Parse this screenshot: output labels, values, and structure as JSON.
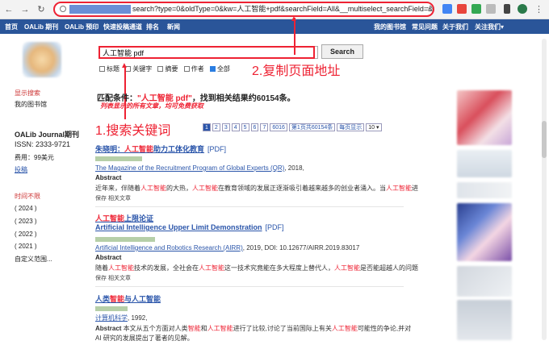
{
  "browser": {
    "url": "search?type=0&oldType=0&kw=人工智能+pdf&searchField=All&__multiselect_searchField=&fromYear=&to",
    "back_icon": "←",
    "forward_icon": "→",
    "reload_icon": "↻"
  },
  "topbar": {
    "items": [
      "首页",
      "OALib 期刊",
      "OALib 预印",
      "快速投稿通道",
      "排名",
      "新闻"
    ],
    "right_items": [
      "我的图书馆",
      "常见问题",
      "关于我们",
      "关注我们▾"
    ]
  },
  "search": {
    "value": "人工智能 pdf",
    "button": "Search",
    "filters": [
      {
        "label": "标题",
        "checked": false
      },
      {
        "label": "关键字",
        "checked": false
      },
      {
        "label": "摘要",
        "checked": false
      },
      {
        "label": "作者",
        "checked": false
      },
      {
        "label": "全部",
        "checked": true
      }
    ]
  },
  "annotations": {
    "copy_url": "2.复制页面地址",
    "search_keyword": "1.搜索关键词"
  },
  "sidebar": {
    "show_search": "显示搜索",
    "my_library": "我的图书馆",
    "journal": "OALib Journal期刊",
    "issn": "ISSN: 2333-9721",
    "fee": "费用：99美元",
    "submit": "投稿",
    "time_limit": "时间不限",
    "years": [
      "( 2024 )",
      "( 2023 )",
      "( 2022 )",
      "( 2021 )"
    ],
    "custom_range": "自定义范围..."
  },
  "results_header": {
    "prefix": "匹配条件：",
    "keyword": "\"人工智能 pdf\"",
    "suffix": "，找到相关结果约60154条。",
    "note": "列表显示的所有文章，均可免费获取"
  },
  "pagination": {
    "pages": [
      "1",
      "2",
      "3",
      "4",
      "5",
      "6",
      "7",
      "6016"
    ],
    "page_label": "第1页共60154条",
    "per_page_label": "每页显示",
    "per_page_value": "10 ▾"
  },
  "results": [
    {
      "title_plain_1": "朱晓明：",
      "title_hl": "人工智能",
      "title_plain_2": "助力工体化教育",
      "tag": "[PDF]",
      "source_link": "The Magazine of the Recruitment Program of Global Experts (QR)",
      "source_rest": ", 2018,",
      "abstract_label": "Abstract",
      "abstract": [
        {
          "t": "近年来，伴随着",
          "hl": false
        },
        {
          "t": "人工智能",
          "hl": true
        },
        {
          "t": "的大热，",
          "hl": false
        },
        {
          "t": "人工智能",
          "hl": true
        },
        {
          "t": "在教育领域的发展正逐渐吸引着越来越多的创业者涌入。当",
          "hl": false
        },
        {
          "t": "人工智能",
          "hl": true
        },
        {
          "t": "进",
          "hl": false
        }
      ],
      "actions": "保存    相关文章"
    },
    {
      "title_hl": "人工智能",
      "title_plain_2": "上限论证",
      "en_title": "Artificial Intelligence Upper Limit Demonstration",
      "tag": "[PDF]",
      "source_link": "Artificial Intelligence and Robotics Research (AIRR)",
      "source_rest": ", 2019, DOI: 10.12677/AIRR.2019.83017",
      "abstract_label": "Abstract",
      "abstract": [
        {
          "t": "随着",
          "hl": false
        },
        {
          "t": "人工智能",
          "hl": true
        },
        {
          "t": "技术的发展，全社会在",
          "hl": false
        },
        {
          "t": "人工智能",
          "hl": true
        },
        {
          "t": "这一技术究竟能在多大程度上替代人，",
          "hl": false
        },
        {
          "t": "人工智能",
          "hl": true
        },
        {
          "t": "是否能超越人的问题",
          "hl": false
        }
      ],
      "actions": "保存    相关文章"
    },
    {
      "title_plain_1": "人类",
      "title_hl": "智能",
      "title_plain_2": "与人工智能",
      "source_link": "计算机科学",
      "source_rest": ", 1992,",
      "abstract_label": "Abstract",
      "abstract": [
        {
          "t": " 本文从五个方面对人类",
          "hl": false
        },
        {
          "t": "智能",
          "hl": true
        },
        {
          "t": "和",
          "hl": false
        },
        {
          "t": "人工智能",
          "hl": true
        },
        {
          "t": "进行了比较,讨论了当前国际上有关",
          "hl": false
        },
        {
          "t": "人工智能",
          "hl": true
        },
        {
          "t": "可能性的争论,并对",
          "hl": false
        }
      ],
      "abstract_line2": "AI 研究的发展提出了著者的见解。"
    }
  ],
  "colors": {
    "annotation_red": "#e22233",
    "topbar_blue": "#2a5599",
    "link_blue": "#2a55aa"
  }
}
